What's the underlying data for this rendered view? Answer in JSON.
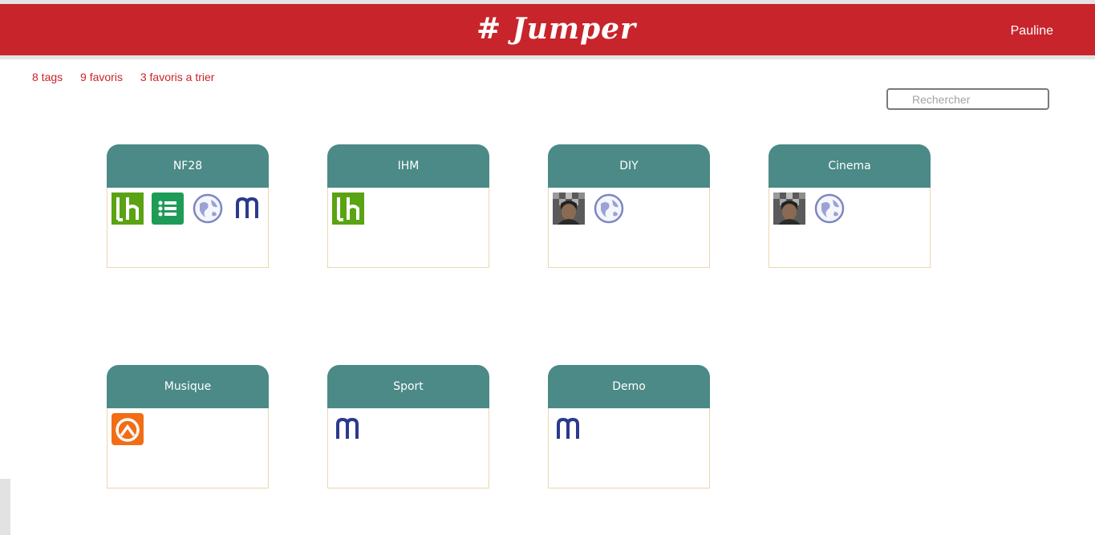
{
  "header": {
    "logo": "# Jumper",
    "user": "Pauline"
  },
  "stats": {
    "tags": "8 tags",
    "favoris": "9 favoris",
    "to_sort": "3 favoris a trier"
  },
  "search": {
    "placeholder": "Rechercher"
  },
  "colors": {
    "brand_red": "#c8242b",
    "card_teal": "#4b8a86",
    "card_border": "#ead7ae"
  },
  "tags": [
    {
      "name": "NF28",
      "favorites": [
        "lh-icon",
        "list-icon",
        "globe-icon",
        "m-icon"
      ]
    },
    {
      "name": "IHM",
      "favorites": [
        "lh-icon"
      ]
    },
    {
      "name": "DIY",
      "favorites": [
        "portrait-icon",
        "globe-icon"
      ]
    },
    {
      "name": "Cinema",
      "favorites": [
        "portrait-icon",
        "globe-icon"
      ]
    },
    {
      "name": "Musique",
      "favorites": [
        "arc-icon"
      ]
    },
    {
      "name": "Sport",
      "favorites": [
        "m-icon"
      ]
    },
    {
      "name": "Demo",
      "favorites": [
        "m-icon"
      ]
    }
  ]
}
